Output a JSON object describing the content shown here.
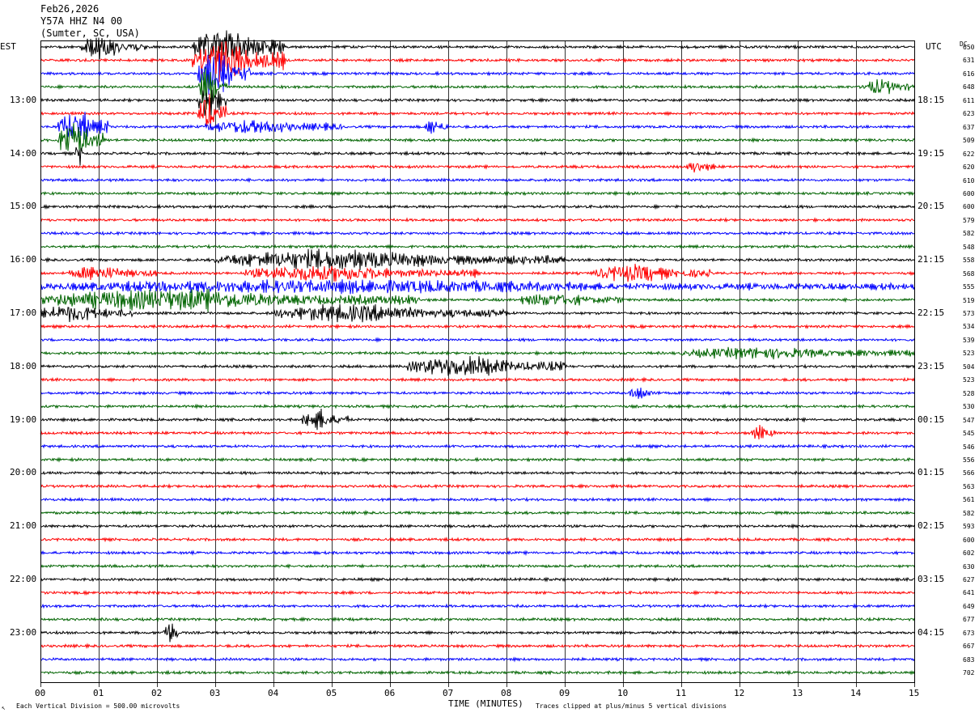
{
  "header": {
    "date": "Feb26,2026",
    "station": "Y57A HHZ N4 00",
    "location": "(Sumter, SC, USA)"
  },
  "left_zone": "EST",
  "right_zone": "UTC",
  "dc_label": "DC",
  "footer": {
    "scale": "Each Vertical Division =  500.00 microvolts",
    "clip": "Traces clipped at plus/minus 5 vertical divisions"
  },
  "colors": {
    "trace_cycle": [
      "#000000",
      "#ff0000",
      "#0000ff",
      "#006400"
    ],
    "grid": "#000000",
    "background": "#ffffff"
  },
  "chart_data": {
    "type": "line",
    "title": "Feb26,2026 Y57A HHZ N4 00 (Sumter, SC, USA)",
    "xlabel": "TIME (MINUTES)",
    "xlim": [
      0,
      15
    ],
    "x_ticks": [
      "00",
      "01",
      "02",
      "03",
      "04",
      "05",
      "06",
      "07",
      "08",
      "09",
      "10",
      "11",
      "12",
      "13",
      "14",
      "15"
    ],
    "rows_per_hour": 4,
    "est_hour_labels": [
      "13:00",
      "14:00",
      "15:00",
      "16:00",
      "17:00",
      "18:00",
      "19:00",
      "20:00",
      "21:00",
      "22:00",
      "23:00"
    ],
    "utc_hour_labels": [
      "18:15",
      "19:15",
      "20:15",
      "21:15",
      "22:15",
      "23:15",
      "00:15",
      "01:15",
      "02:15",
      "03:15",
      "04:15"
    ],
    "dc_offsets": [
      650,
      631,
      616,
      648,
      611,
      623,
      637,
      509,
      622,
      620,
      610,
      600,
      600,
      579,
      582,
      548,
      558,
      568,
      555,
      519,
      573,
      534,
      539,
      523,
      504,
      523,
      528,
      530,
      547,
      545,
      546,
      556,
      566,
      563,
      561,
      582,
      593,
      600,
      602,
      630,
      627,
      641,
      649,
      677,
      673,
      667,
      683,
      702
    ],
    "events": [
      {
        "row": 0,
        "start_min": 0.7,
        "end_min": 1.8,
        "amplitude": 2.5
      },
      {
        "row": 0,
        "start_min": 2.6,
        "end_min": 4.2,
        "amplitude": 5
      },
      {
        "row": 1,
        "start_min": 2.6,
        "end_min": 4.2,
        "amplitude": 5
      },
      {
        "row": 2,
        "start_min": 2.7,
        "end_min": 3.6,
        "amplitude": 5
      },
      {
        "row": 3,
        "start_min": 2.7,
        "end_min": 3.2,
        "amplitude": 5
      },
      {
        "row": 4,
        "start_min": 2.7,
        "end_min": 3.2,
        "amplitude": 5
      },
      {
        "row": 5,
        "start_min": 2.7,
        "end_min": 3.2,
        "amplitude": 5
      },
      {
        "row": 6,
        "start_min": 0.3,
        "end_min": 1.2,
        "amplitude": 4
      },
      {
        "row": 6,
        "start_min": 2.8,
        "end_min": 5.2,
        "amplitude": 1.6
      },
      {
        "row": 6,
        "start_min": 6.6,
        "end_min": 7.0,
        "amplitude": 1.8
      },
      {
        "row": 7,
        "start_min": 0.3,
        "end_min": 1.1,
        "amplitude": 5
      },
      {
        "row": 8,
        "start_min": 0.6,
        "end_min": 0.8,
        "amplitude": 3
      },
      {
        "row": 3,
        "start_min": 14.1,
        "end_min": 15.0,
        "amplitude": 1.8
      },
      {
        "row": 9,
        "start_min": 11.1,
        "end_min": 11.6,
        "amplitude": 1.5
      },
      {
        "row": 16,
        "start_min": 3.0,
        "end_min": 9.0,
        "amplitude": 2.2
      },
      {
        "row": 17,
        "start_min": 0.5,
        "end_min": 2.0,
        "amplitude": 1.5
      },
      {
        "row": 17,
        "start_min": 3.5,
        "end_min": 7.5,
        "amplitude": 1.8
      },
      {
        "row": 17,
        "start_min": 9.5,
        "end_min": 11.5,
        "amplitude": 2.0
      },
      {
        "row": 18,
        "start_min": 0.0,
        "end_min": 15.0,
        "amplitude": 1.4
      },
      {
        "row": 19,
        "start_min": 0.0,
        "end_min": 6.5,
        "amplitude": 2.4
      },
      {
        "row": 19,
        "start_min": 8.2,
        "end_min": 10.0,
        "amplitude": 1.5
      },
      {
        "row": 20,
        "start_min": 0.0,
        "end_min": 1.6,
        "amplitude": 2.0
      },
      {
        "row": 20,
        "start_min": 4.0,
        "end_min": 8.0,
        "amplitude": 2.0
      },
      {
        "row": 23,
        "start_min": 11.0,
        "end_min": 15.0,
        "amplitude": 1.2
      },
      {
        "row": 24,
        "start_min": 6.3,
        "end_min": 9.0,
        "amplitude": 2.5
      },
      {
        "row": 26,
        "start_min": 10.1,
        "end_min": 10.6,
        "amplitude": 1.5
      },
      {
        "row": 28,
        "start_min": 4.5,
        "end_min": 5.3,
        "amplitude": 2.3
      },
      {
        "row": 29,
        "start_min": 12.2,
        "end_min": 12.6,
        "amplitude": 1.5
      },
      {
        "row": 44,
        "start_min": 2.1,
        "end_min": 2.4,
        "amplitude": 3.0
      }
    ]
  }
}
